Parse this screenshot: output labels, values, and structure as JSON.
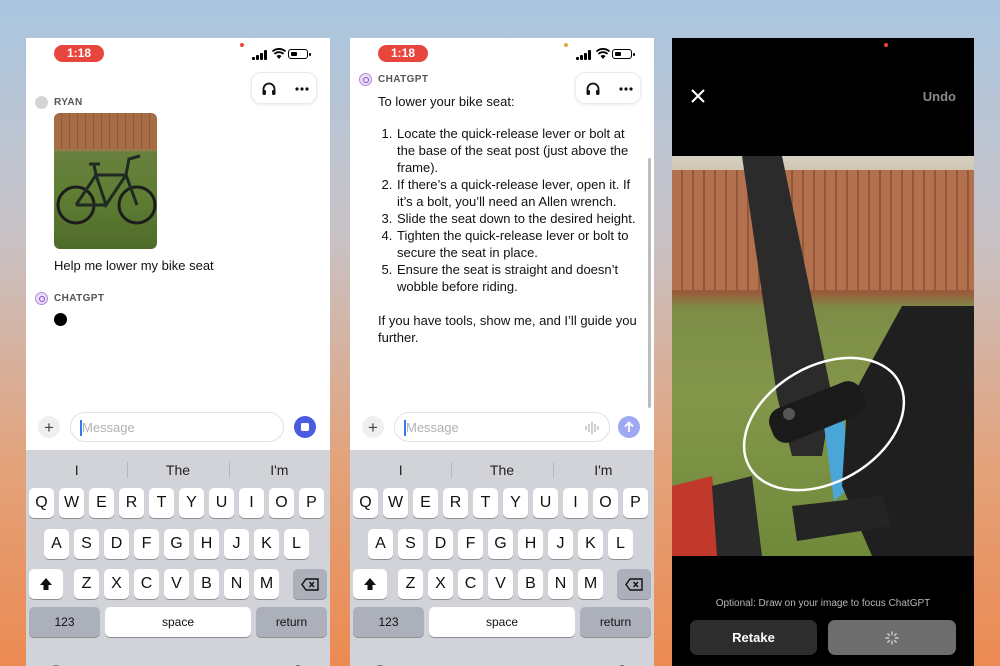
{
  "panel1": {
    "status": {
      "time": "1:18"
    },
    "user_name": "RYAN",
    "user_message": "Help me lower my bike seat",
    "assistant_name": "CHATGPT",
    "input_placeholder": "Message",
    "suggestions": [
      "I",
      "The",
      "I'm"
    ]
  },
  "panel2": {
    "status": {
      "time": "1:18"
    },
    "assistant_name": "CHATGPT",
    "reply_intro": "To lower your bike seat:",
    "steps": [
      "Locate the quick-release lever or bolt at the base of the seat post (just above the frame).",
      "If there’s a quick-release lever, open it. If it’s a bolt, you’ll need an Allen wrench.",
      "Slide the seat down to the desired height.",
      "Tighten the quick-release lever or bolt to secure the seat in place.",
      "Ensure the seat is straight and doesn’t wobble before riding."
    ],
    "reply_outro": "If you have tools, show me, and I’ll guide you further.",
    "input_placeholder": "Message",
    "suggestions": [
      "I",
      "The",
      "I'm"
    ]
  },
  "keyboard": {
    "row1": [
      "Q",
      "W",
      "E",
      "R",
      "T",
      "Y",
      "U",
      "I",
      "O",
      "P"
    ],
    "row2": [
      "A",
      "S",
      "D",
      "F",
      "G",
      "H",
      "J",
      "K",
      "L"
    ],
    "row3": [
      "Z",
      "X",
      "C",
      "V",
      "B",
      "N",
      "M"
    ],
    "numbers_label": "123",
    "space_label": "space",
    "return_label": "return"
  },
  "panel3": {
    "undo_label": "Undo",
    "hint": "Optional: Draw on your image to focus ChatGPT",
    "retake_label": "Retake"
  },
  "colors": {
    "time_pill": "#e8453c",
    "stop_button": "#4a5be0",
    "send_button": "#9fa8f3",
    "keyboard_bg": "#d1d3d9"
  }
}
